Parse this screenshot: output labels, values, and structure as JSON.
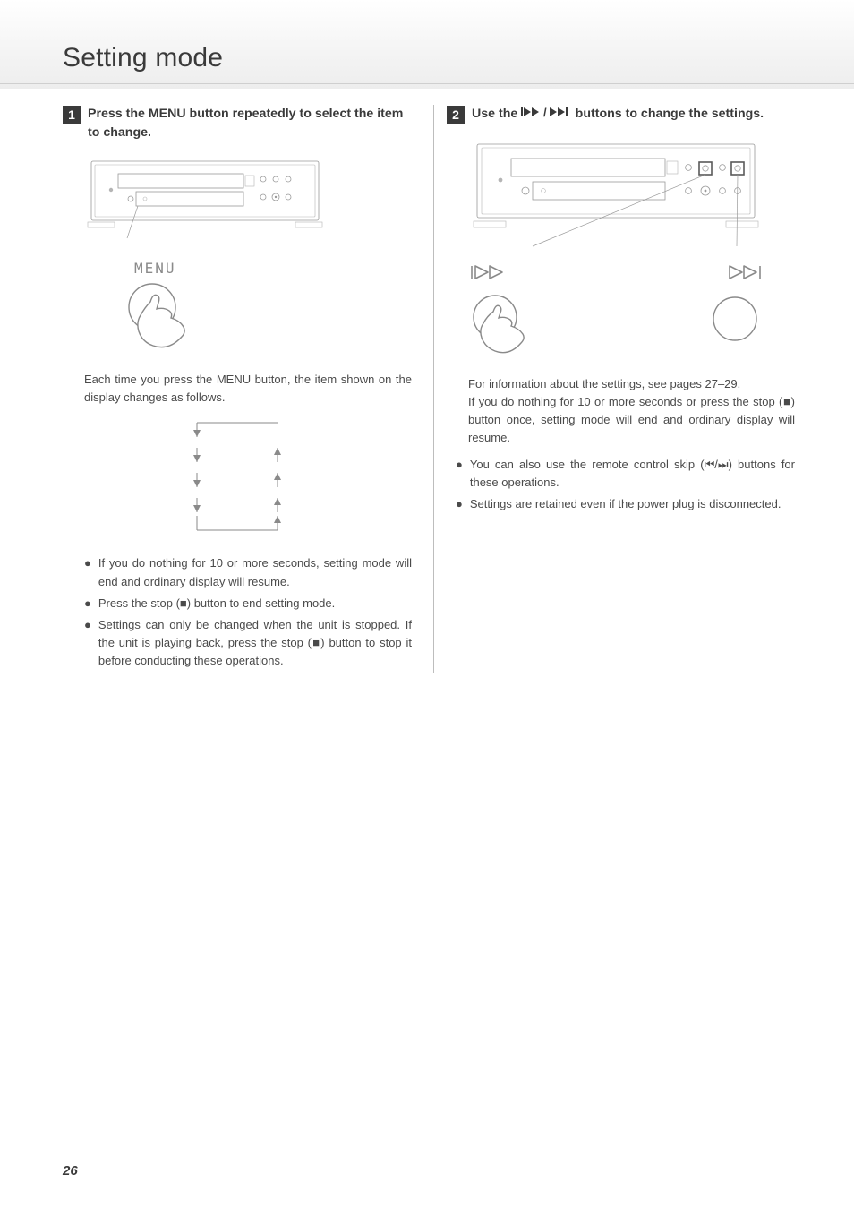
{
  "page": {
    "title": "Setting mode",
    "number": "26"
  },
  "step1": {
    "number": "1",
    "text_a": "Press the MENU button repeatedly to select the item",
    "text_b": "to change.",
    "menu_label": "MENU",
    "after_fig_para": "Each time you press the MENU button, the item shown on the display changes as follows.",
    "bullets": [
      "If you do nothing for 10 or more seconds, setting mode will end and ordinary display will resume.",
      "Press the stop (■) button to end setting mode.",
      "Settings can only be changed when the unit is stopped. If the unit is playing back, press the stop (■) button to stop it before conducting these operations."
    ]
  },
  "step2": {
    "number": "2",
    "text_a": "Use the ",
    "text_b": " buttons to change the settings.",
    "skip_glyph": "⏮/⏭",
    "info_line": "For information about the settings, see pages 27–29.",
    "resume_line": "If you do nothing for 10 or more seconds or press the stop (■) button once, setting mode will end and ordinary display will resume.",
    "bullets": [
      "You can also use the remote control skip (⏮/⏭) buttons for these operations.",
      "Settings are retained even if the power plug is disconnected."
    ]
  },
  "icons": {
    "prev": "prev-track-icon",
    "next": "next-track-icon",
    "stop": "stop-icon",
    "hand": "pointing-hand-icon"
  }
}
